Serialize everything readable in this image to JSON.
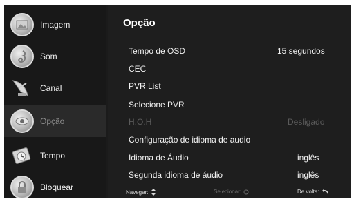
{
  "sidebar": {
    "items": [
      {
        "label": "Imagem",
        "icon": "picture-icon",
        "active": false
      },
      {
        "label": "Som",
        "icon": "music-note-icon",
        "active": false
      },
      {
        "label": "Canal",
        "icon": "satellite-dish-icon",
        "active": false
      },
      {
        "label": "Opção",
        "icon": "eye-icon",
        "active": true
      },
      {
        "label": "Tempo",
        "icon": "clock-icon",
        "active": false
      },
      {
        "label": "Bloquear",
        "icon": "padlock-icon",
        "active": false
      }
    ]
  },
  "main": {
    "title": "Opção",
    "rows": [
      {
        "label": "Tempo de OSD",
        "value": "15 segundos",
        "enabled": true
      },
      {
        "label": "CEC",
        "value": "",
        "enabled": true
      },
      {
        "label": "PVR List",
        "value": "",
        "enabled": true
      },
      {
        "label": "Selecione PVR",
        "value": "",
        "enabled": true
      },
      {
        "label": "H.O.H",
        "value": "Desligado",
        "enabled": false
      },
      {
        "label": "Configuração de idioma de audio",
        "value": "",
        "enabled": true
      },
      {
        "label": "Idioma de Áudio",
        "value": "inglês",
        "enabled": true
      },
      {
        "label": "Segunda idioma de áudio",
        "value": "inglês",
        "enabled": true
      }
    ]
  },
  "footer": {
    "navigate": "Navegar:",
    "select": "Selecionar:",
    "back": "De volta:"
  },
  "colors": {
    "background": "#1b1b1b",
    "sidebar": "#181818",
    "active_item": "#2a2a2a",
    "text": "#f2f2f2",
    "disabled_text": "#5a5a5a"
  }
}
